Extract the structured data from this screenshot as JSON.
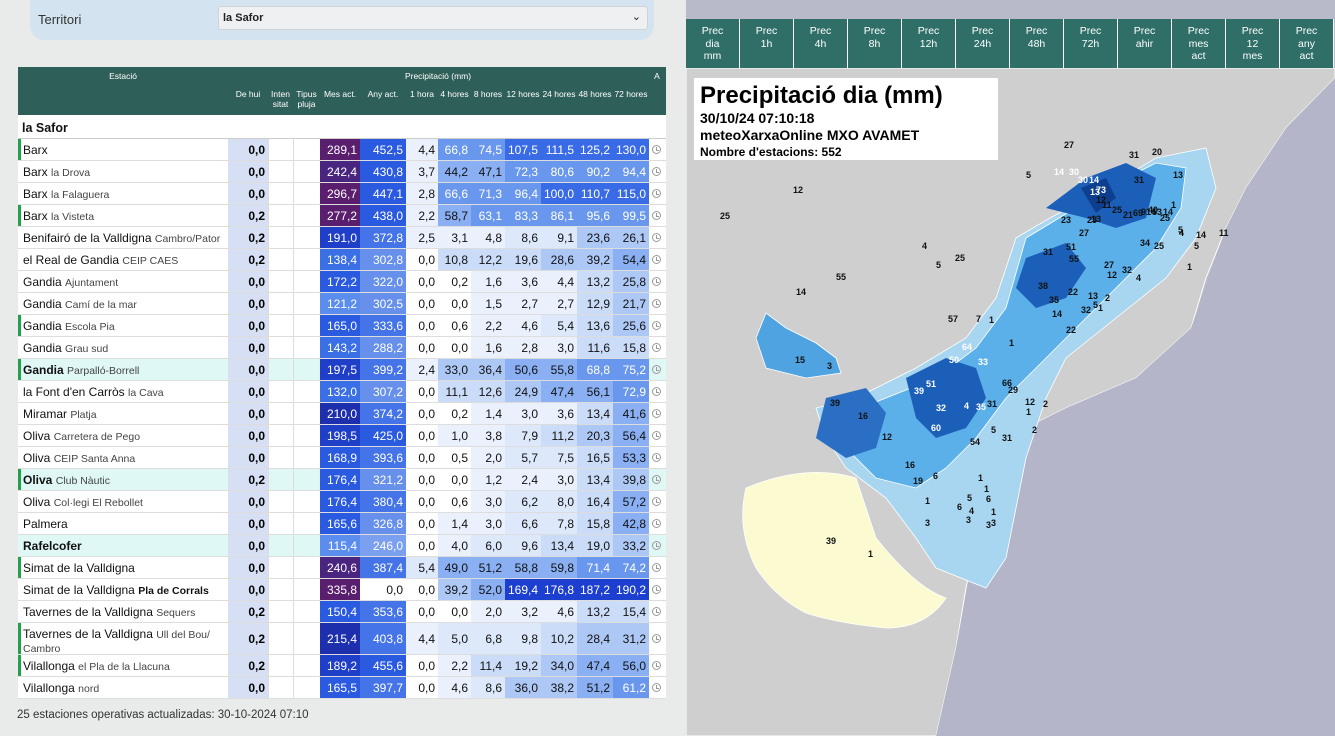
{
  "territory": {
    "label": "Territori",
    "selected": "la Safor"
  },
  "table": {
    "col_station": "Estació",
    "col_precip": "Precipitació (mm)",
    "col_a": "A",
    "cols": [
      "De hui",
      "Inten sitat",
      "Tipus pluja",
      "Mes act.",
      "Any act.",
      "1 hora",
      "4 hores",
      "8 hores",
      "12 hores",
      "24 hores",
      "48 hores",
      "72 hores"
    ],
    "region": "la Safor",
    "rows": [
      {
        "name": "Barx",
        "sub": "",
        "bar": true,
        "hl": false,
        "dh": "0,0",
        "mes": "289,1",
        "any": "452,5",
        "h1": "4,4",
        "h4": "66,8",
        "h8": "74,5",
        "h12": "107,5",
        "h24": "111,5",
        "h48": "125,2",
        "h72": "130,0"
      },
      {
        "name": "Barx",
        "sub": "la Drova",
        "bar": false,
        "hl": false,
        "dh": "0,0",
        "mes": "242,4",
        "any": "430,8",
        "h1": "3,7",
        "h4": "44,2",
        "h8": "47,1",
        "h12": "72,3",
        "h24": "80,6",
        "h48": "90,2",
        "h72": "94,4"
      },
      {
        "name": "Barx",
        "sub": "la Falaguera",
        "bar": false,
        "hl": false,
        "dh": "0,0",
        "mes": "296,7",
        "any": "447,1",
        "h1": "2,8",
        "h4": "66,6",
        "h8": "71,3",
        "h12": "96,4",
        "h24": "100,0",
        "h48": "110,7",
        "h72": "115,0"
      },
      {
        "name": "Barx",
        "sub": "la Visteta",
        "bar": true,
        "hl": false,
        "dh": "0,2",
        "mes": "277,2",
        "any": "438,0",
        "h1": "2,2",
        "h4": "58,7",
        "h8": "63,1",
        "h12": "83,3",
        "h24": "86,1",
        "h48": "95,6",
        "h72": "99,5"
      },
      {
        "name": "Benifairó de la Valldigna",
        "sub": "Cambro/Pator",
        "bar": false,
        "hl": false,
        "dh": "0,2",
        "mes": "191,0",
        "any": "372,8",
        "h1": "2,5",
        "h4": "3,1",
        "h8": "4,8",
        "h12": "8,6",
        "h24": "9,1",
        "h48": "23,6",
        "h72": "26,1"
      },
      {
        "name": "el Real de Gandia",
        "sub": "CEIP CAES N.S.Amparo",
        "bar": false,
        "hl": false,
        "dh": "0,2",
        "mes": "138,4",
        "any": "302,8",
        "h1": "0,0",
        "h4": "10,8",
        "h8": "12,2",
        "h12": "19,6",
        "h24": "28,6",
        "h48": "39,2",
        "h72": "54,4"
      },
      {
        "name": "Gandia",
        "sub": "Ajuntament",
        "bar": false,
        "hl": false,
        "dh": "0,0",
        "mes": "172,2",
        "any": "322,0",
        "h1": "0,0",
        "h4": "0,2",
        "h8": "1,6",
        "h12": "3,6",
        "h24": "4,4",
        "h48": "13,2",
        "h72": "25,8"
      },
      {
        "name": "Gandia",
        "sub": "Camí de la mar",
        "bar": false,
        "hl": false,
        "dh": "0,0",
        "mes": "121,2",
        "any": "302,5",
        "h1": "0,0",
        "h4": "0,0",
        "h8": "1,5",
        "h12": "2,7",
        "h24": "2,7",
        "h48": "12,9",
        "h72": "21,7"
      },
      {
        "name": "Gandia",
        "sub": "Escola Pia",
        "bar": true,
        "hl": false,
        "dh": "0,0",
        "mes": "165,0",
        "any": "333,6",
        "h1": "0,0",
        "h4": "0,6",
        "h8": "2,2",
        "h12": "4,6",
        "h24": "5,4",
        "h48": "13,6",
        "h72": "25,6"
      },
      {
        "name": "Gandia",
        "sub": "Grau sud",
        "bar": false,
        "hl": false,
        "dh": "0,0",
        "mes": "143,2",
        "any": "288,2",
        "h1": "0,0",
        "h4": "0,0",
        "h8": "1,6",
        "h12": "2,8",
        "h24": "3,0",
        "h48": "11,6",
        "h72": "15,8"
      },
      {
        "name": "Gandia",
        "sub": "Parpalló-Borrell",
        "bar": true,
        "hl": true,
        "bold": true,
        "dh": "0,0",
        "mes": "197,5",
        "any": "399,2",
        "h1": "2,4",
        "h4": "33,0",
        "h8": "36,4",
        "h12": "50,6",
        "h24": "55,8",
        "h48": "68,8",
        "h72": "75,2"
      },
      {
        "name": "la Font d'en Carròs",
        "sub": "la Cava",
        "bar": false,
        "hl": false,
        "dh": "0,0",
        "mes": "132,0",
        "any": "307,2",
        "h1": "0,0",
        "h4": "11,1",
        "h8": "12,6",
        "h12": "24,9",
        "h24": "47,4",
        "h48": "56,1",
        "h72": "72,9"
      },
      {
        "name": "Miramar",
        "sub": "Platja",
        "bar": false,
        "hl": false,
        "dh": "0,0",
        "mes": "210,0",
        "any": "374,2",
        "h1": "0,0",
        "h4": "0,2",
        "h8": "1,4",
        "h12": "3,0",
        "h24": "3,6",
        "h48": "13,4",
        "h72": "41,6"
      },
      {
        "name": "Oliva",
        "sub": "Carretera de Pego",
        "bar": false,
        "hl": false,
        "dh": "0,0",
        "mes": "198,5",
        "any": "425,0",
        "h1": "0,0",
        "h4": "1,0",
        "h8": "3,8",
        "h12": "7,9",
        "h24": "11,2",
        "h48": "20,3",
        "h72": "56,4"
      },
      {
        "name": "Oliva",
        "sub": "CEIP Santa Anna",
        "bar": false,
        "hl": false,
        "dh": "0,0",
        "mes": "168,9",
        "any": "393,6",
        "h1": "0,0",
        "h4": "0,5",
        "h8": "2,0",
        "h12": "5,7",
        "h24": "7,5",
        "h48": "16,5",
        "h72": "53,3"
      },
      {
        "name": "Oliva",
        "sub": "Club Nàutic",
        "bar": true,
        "hl": true,
        "bold": true,
        "dh": "0,2",
        "mes": "176,4",
        "any": "321,2",
        "h1": "0,0",
        "h4": "0,0",
        "h8": "1,2",
        "h12": "2,4",
        "h24": "3,0",
        "h48": "13,4",
        "h72": "39,8"
      },
      {
        "name": "Oliva",
        "sub": "Col·legi El Rebollet",
        "bar": false,
        "hl": false,
        "dh": "0,0",
        "mes": "176,4",
        "any": "380,4",
        "h1": "0,0",
        "h4": "0,6",
        "h8": "3,0",
        "h12": "6,2",
        "h24": "8,0",
        "h48": "16,4",
        "h72": "57,2"
      },
      {
        "name": "Palmera",
        "sub": "",
        "bar": false,
        "hl": false,
        "dh": "0,0",
        "mes": "165,6",
        "any": "326,8",
        "h1": "0,0",
        "h4": "1,4",
        "h8": "3,0",
        "h12": "6,6",
        "h24": "7,8",
        "h48": "15,8",
        "h72": "42,8"
      },
      {
        "name": "Rafelcofer",
        "sub": "",
        "bar": false,
        "hl": true,
        "bold": true,
        "dh": "0,0",
        "mes": "115,4",
        "any": "246,0",
        "h1": "0,0",
        "h4": "4,0",
        "h8": "6,0",
        "h12": "9,6",
        "h24": "13,4",
        "h48": "19,0",
        "h72": "33,2"
      },
      {
        "name": "Simat de la Valldigna",
        "sub": "",
        "bar": true,
        "hl": false,
        "dh": "0,0",
        "mes": "240,6",
        "any": "387,4",
        "h1": "5,4",
        "h4": "49,0",
        "h8": "51,2",
        "h12": "58,8",
        "h24": "59,8",
        "h48": "71,4",
        "h72": "74,2"
      },
      {
        "name": "Simat de la Valldigna",
        "sub": "Pla de Corrals",
        "bar": false,
        "hl": false,
        "bold2": true,
        "dh": "0,0",
        "mes": "335,8",
        "any": "0,0",
        "h1": "0,0",
        "h4": "39,2",
        "h8": "52,0",
        "h12": "169,4",
        "h24": "176,8",
        "h48": "187,2",
        "h72": "190,2"
      },
      {
        "name": "Tavernes de la Valldigna",
        "sub": "Sequers",
        "bar": false,
        "hl": false,
        "dh": "0,2",
        "mes": "150,4",
        "any": "353,6",
        "h1": "0,0",
        "h4": "0,0",
        "h8": "2,0",
        "h12": "3,2",
        "h24": "4,6",
        "h48": "13,2",
        "h72": "15,4"
      },
      {
        "name": "Tavernes de la Valldigna",
        "sub": "Ull del Bou/ Cambro",
        "bar": true,
        "hl": false,
        "tall": true,
        "dh": "0,2",
        "mes": "215,4",
        "any": "403,8",
        "h1": "4,4",
        "h4": "5,0",
        "h8": "6,8",
        "h12": "9,8",
        "h24": "10,2",
        "h48": "28,4",
        "h72": "31,2"
      },
      {
        "name": "Vilallonga",
        "sub": "el Pla de la Llacuna",
        "bar": true,
        "hl": false,
        "dh": "0,2",
        "mes": "189,2",
        "any": "455,6",
        "h1": "0,0",
        "h4": "2,2",
        "h8": "11,4",
        "h12": "19,2",
        "h24": "34,0",
        "h48": "47,4",
        "h72": "56,0"
      },
      {
        "name": "Vilallonga",
        "sub": "nord",
        "bar": false,
        "hl": false,
        "dh": "0,0",
        "mes": "165,5",
        "any": "397,7",
        "h1": "0,0",
        "h4": "4,6",
        "h8": "8,6",
        "h12": "36,0",
        "h24": "38,2",
        "h48": "51,2",
        "h72": "61,2"
      }
    ],
    "footer": "25 estaciones operativas actualizadas: 30-10-2024 07:10"
  },
  "tabs": [
    [
      "Prec",
      "dia",
      "mm"
    ],
    [
      "Prec",
      "1h"
    ],
    [
      "Prec",
      "4h"
    ],
    [
      "Prec",
      "8h"
    ],
    [
      "Prec",
      "12h"
    ],
    [
      "Prec",
      "24h"
    ],
    [
      "Prec",
      "48h"
    ],
    [
      "Prec",
      "72h"
    ],
    [
      "Prec",
      "ahir"
    ],
    [
      "Prec",
      "mes",
      "act"
    ],
    [
      "Prec",
      "12",
      "mes"
    ],
    [
      "Prec",
      "any",
      "act"
    ]
  ],
  "map": {
    "title": "Precipitació dia (mm)",
    "datetime": "30/10/24 07:10:18",
    "source": "meteoXarxaOnline MXO AVAMET",
    "count": "Nombre d'estacions: 552",
    "labels": [
      "27",
      "31",
      "20",
      "13",
      "5",
      "14",
      "30",
      "30",
      "14",
      "73",
      "31",
      "13",
      "12",
      "25",
      "14",
      "9",
      "69",
      "40",
      "53",
      "14",
      "1",
      "27",
      "23",
      "11",
      "21",
      "25",
      "5",
      "14",
      "23",
      "13",
      "34",
      "11",
      "25",
      "4",
      "5",
      "31",
      "51",
      "55",
      "27",
      "12",
      "32",
      "4",
      "1",
      "38",
      "22",
      "1",
      "35",
      "13",
      "2",
      "14",
      "32",
      "22",
      "5",
      "57",
      "7",
      "1",
      "1",
      "64",
      "33",
      "50",
      "51",
      "39",
      "32",
      "66",
      "4",
      "35",
      "31",
      "29",
      "2",
      "12",
      "1",
      "39",
      "16",
      "60",
      "54",
      "5",
      "12",
      "31",
      "2",
      "16",
      "19",
      "6",
      "1",
      "3",
      "1",
      "5",
      "6",
      "4",
      "1",
      "6",
      "3",
      "3",
      "1",
      "3",
      "39",
      "15",
      "3",
      "1",
      "55",
      "14",
      "12",
      "25",
      "4",
      "5",
      "25"
    ]
  }
}
